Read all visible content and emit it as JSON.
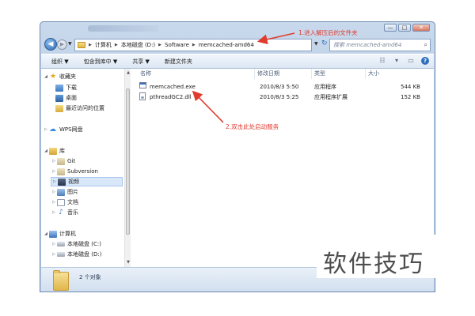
{
  "window": {
    "caption_buttons": {
      "minimize": "—",
      "maximize": "□",
      "close": "✕"
    }
  },
  "address_bar": {
    "crumbs": [
      "计算机",
      "本地磁盘 (D:)",
      "Software",
      "memcached-amd64"
    ],
    "search_placeholder": "搜索 memcached-amd64"
  },
  "toolbar": {
    "items": [
      "组织 ▼",
      "包含到库中 ▼",
      "共享 ▼",
      "新建文件夹"
    ]
  },
  "nav_pane": {
    "favorites": {
      "label": "收藏夹",
      "items": [
        "下载",
        "桌面",
        "最近访问的位置"
      ]
    },
    "cloud": {
      "label": "WPS网盘"
    },
    "libraries": {
      "label": "库",
      "items": [
        "Git",
        "Subversion",
        "视频",
        "图片",
        "文档",
        "音乐"
      ]
    },
    "computer": {
      "label": "计算机",
      "items": [
        "本地磁盘 (C:)",
        "本地磁盘 (D:)"
      ]
    }
  },
  "file_list": {
    "columns": [
      "名称",
      "修改日期",
      "类型",
      "大小"
    ],
    "rows": [
      {
        "name": "memcached.exe",
        "date": "2010/8/3 5:50",
        "type": "应用程序",
        "size": "544 KB"
      },
      {
        "name": "pthreadGC2.dll",
        "date": "2010/8/3 5:25",
        "type": "应用程序扩展",
        "size": "152 KB"
      }
    ]
  },
  "details_pane": {
    "text": "2 个对象"
  },
  "annotations": {
    "step1": "1.进入解压后的文件夹",
    "step2": "2.双击此处启动服务",
    "color": "#e03b2e"
  },
  "watermark": {
    "text": "软件技巧"
  }
}
